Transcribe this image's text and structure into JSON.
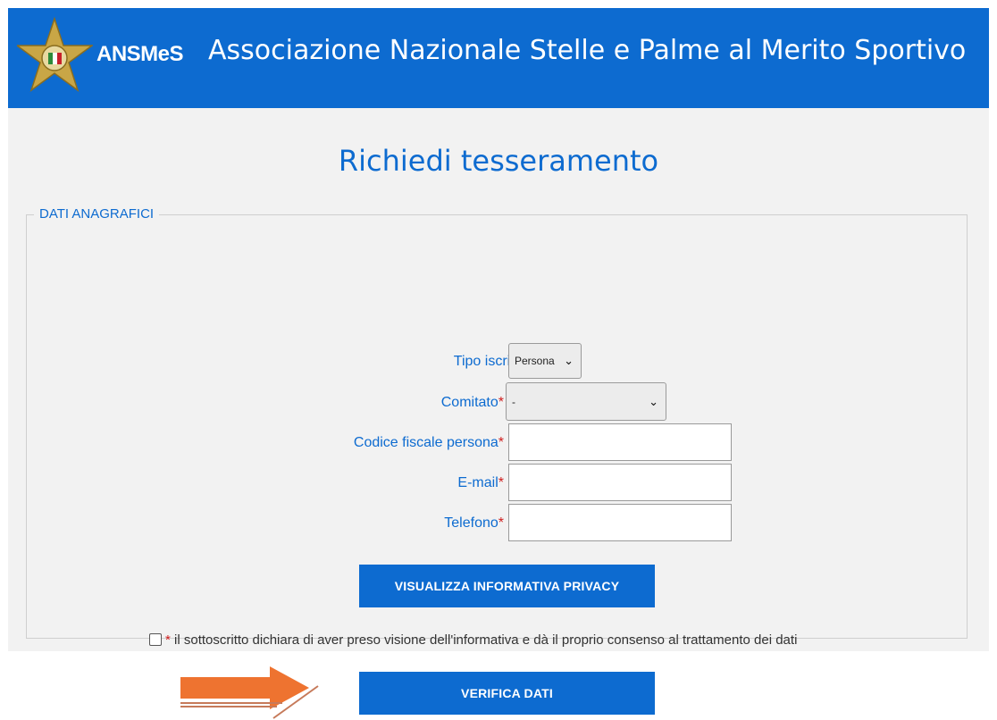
{
  "header": {
    "logo_text": "ANSMeS",
    "site_title": "Associazione Nazionale Stelle e Palme al Merito Sportivo"
  },
  "page": {
    "title": "Richiedi tesseramento"
  },
  "form": {
    "legend": "DATI ANAGRAFICI",
    "required_marker": "*",
    "fields": {
      "tipo_iscritto": {
        "label": "Tipo iscritto",
        "value": "Persona"
      },
      "comitato": {
        "label": "Comitato",
        "value": "-"
      },
      "codice_fiscale": {
        "label": "Codice fiscale persona",
        "value": ""
      },
      "email": {
        "label": "E-mail",
        "value": ""
      },
      "telefono": {
        "label": "Telefono",
        "value": ""
      }
    },
    "privacy_button": "VISUALIZZA INFORMATIVA PRIVACY",
    "consent_text": "il sottoscritto dichiara di aver preso visione dell'informativa e dà il proprio consenso al trattamento dei dati",
    "consent_checked": false,
    "verify_button": "VERIFICA DATI"
  },
  "icons": {
    "logo": "star-emblem-icon",
    "annotation_arrow": "arrow-right-icon",
    "select_chevron": "chevron-down-icon"
  },
  "colors": {
    "brand_blue": "#0d6bd0",
    "required_red": "#d01e1e",
    "arrow_orange": "#ee7330"
  }
}
